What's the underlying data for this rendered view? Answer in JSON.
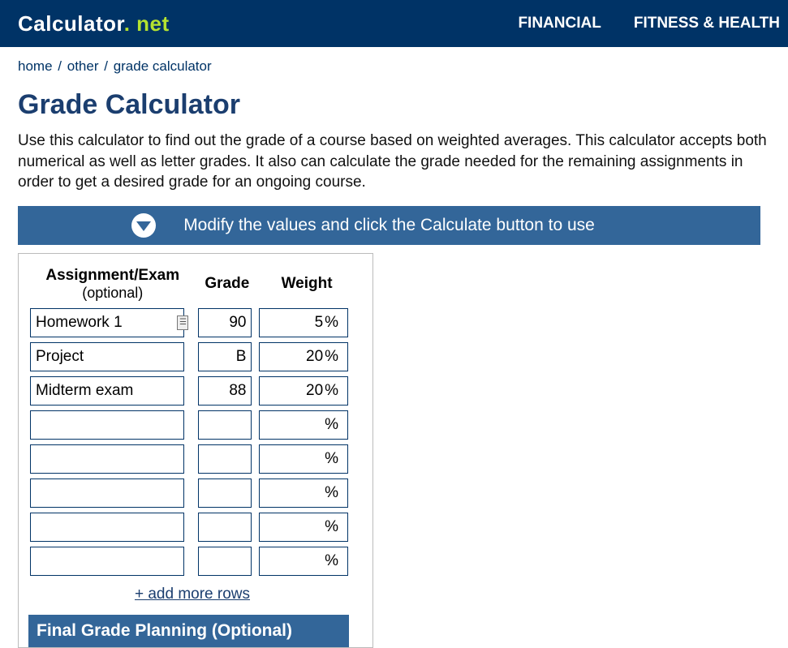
{
  "header": {
    "logo_main": "Calculator",
    "logo_dot": ".",
    "logo_net": " net",
    "nav": [
      "FINANCIAL",
      "FITNESS & HEALTH"
    ]
  },
  "breadcrumbs": {
    "items": [
      "home",
      "other",
      "grade calculator"
    ],
    "sep": "/"
  },
  "title": "Grade Calculator",
  "intro": "Use this calculator to find out the grade of a course based on weighted averages. This calculator accepts both numerical as well as letter grades. It also can calculate the grade needed for the remaining assignments in order to get a desired grade for an ongoing course.",
  "instruction": "Modify the values and click the Calculate button to use",
  "table": {
    "headers": {
      "name": "Assignment/Exam",
      "name_sub": "(optional)",
      "grade": "Grade",
      "weight": "Weight"
    },
    "pct_symbol": "%",
    "rows": [
      {
        "name": "Homework 1",
        "grade": "90",
        "weight": "5",
        "show_save": true
      },
      {
        "name": "Project",
        "grade": "B",
        "weight": "20",
        "show_save": false
      },
      {
        "name": "Midterm exam",
        "grade": "88",
        "weight": "20",
        "show_save": false
      },
      {
        "name": "",
        "grade": "",
        "weight": "",
        "show_save": false
      },
      {
        "name": "",
        "grade": "",
        "weight": "",
        "show_save": false
      },
      {
        "name": "",
        "grade": "",
        "weight": "",
        "show_save": false
      },
      {
        "name": "",
        "grade": "",
        "weight": "",
        "show_save": false
      },
      {
        "name": "",
        "grade": "",
        "weight": "",
        "show_save": false
      }
    ],
    "add_more": "+ add more rows"
  },
  "final_plan": "Final Grade Planning (Optional)"
}
